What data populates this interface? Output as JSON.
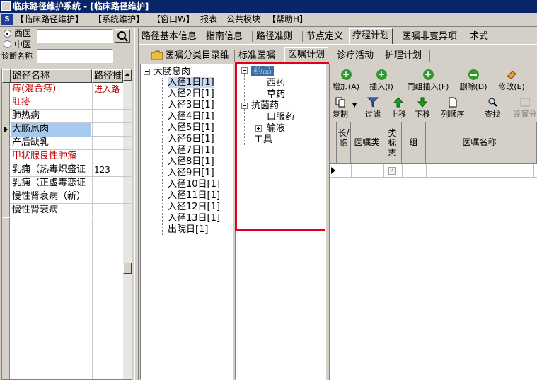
{
  "title": "临床路径维护系统 - [临床路径维护]",
  "menu": [
    "【临床路径维护】",
    "【系统维护】",
    "【窗口W】",
    "报表",
    "公共模块",
    "【帮助H】"
  ],
  "search": {
    "radio_western": "西医",
    "radio_chinese": "中医",
    "diagnosis_label": "诊断名称",
    "diagnosis_value": ""
  },
  "grid": {
    "columns": [
      "路径名称",
      "路径推"
    ],
    "rows": [
      {
        "name": "痔(混合痔)",
        "col2": "进入路",
        "color": "#c00000"
      },
      {
        "name": "肛瘘",
        "col2": "",
        "color": "#c00000"
      },
      {
        "name": "肺热病",
        "col2": "",
        "color": "#000000"
      },
      {
        "name": "大肠息肉",
        "col2": "",
        "color": "#000000",
        "selected": true
      },
      {
        "name": "产后缺乳",
        "col2": "",
        "color": "#000000"
      },
      {
        "name": "甲状腺良性肿瘤",
        "col2": "",
        "color": "#c00000"
      },
      {
        "name": "乳痈（热毒炽盛证",
        "col2": "123",
        "color": "#000000"
      },
      {
        "name": "乳痈（正虚毒恋证",
        "col2": "",
        "color": "#000000"
      },
      {
        "name": "慢性肾衰病（新）",
        "col2": "",
        "color": "#000000"
      },
      {
        "name": "慢性肾衰病",
        "col2": "",
        "color": "#000000"
      }
    ]
  },
  "main_tabs": [
    "路径基本信息",
    "指南信息",
    "路径准则",
    "节点定义",
    "疗程计划",
    "医嘱非变异项",
    "术式"
  ],
  "sub_tabs": [
    "医嘱分类目录维",
    "标准医嘱",
    "医嘱计划",
    "诊疗活动",
    "护理计划"
  ],
  "day_tree": {
    "root": "大肠息肉",
    "items": [
      "入径1日[1]",
      "入径2日[1]",
      "入径3日[1]",
      "入径4日[1]",
      "入径5日[1]",
      "入径6日[1]",
      "入径7日[1]",
      "入径8日[1]",
      "入径9日[1]",
      "入径10日[1]",
      "入径11日[1]",
      "入径12日[1]",
      "入径13日[1]",
      "出院日[1]"
    ]
  },
  "category_tree": {
    "root": "药品",
    "items": [
      "西药",
      "草药",
      "抗菌药",
      "口服药",
      "输液",
      "工具"
    ]
  },
  "toolbar1": [
    "增加(A)",
    "插入(I)",
    "同组插入(F)",
    "删除(D)",
    "修改(E)"
  ],
  "toolbar2": [
    "复制",
    "过滤",
    "上移",
    "下移",
    "列顺序",
    "查找",
    "设置分"
  ],
  "order_grid": {
    "columns": [
      "长/临",
      "医嘱类",
      "类标志",
      "组",
      "医嘱名称"
    ]
  },
  "colors": {
    "titlebar": "#0a246a",
    "highlight": "#e0001a",
    "red_text": "#c00000"
  }
}
